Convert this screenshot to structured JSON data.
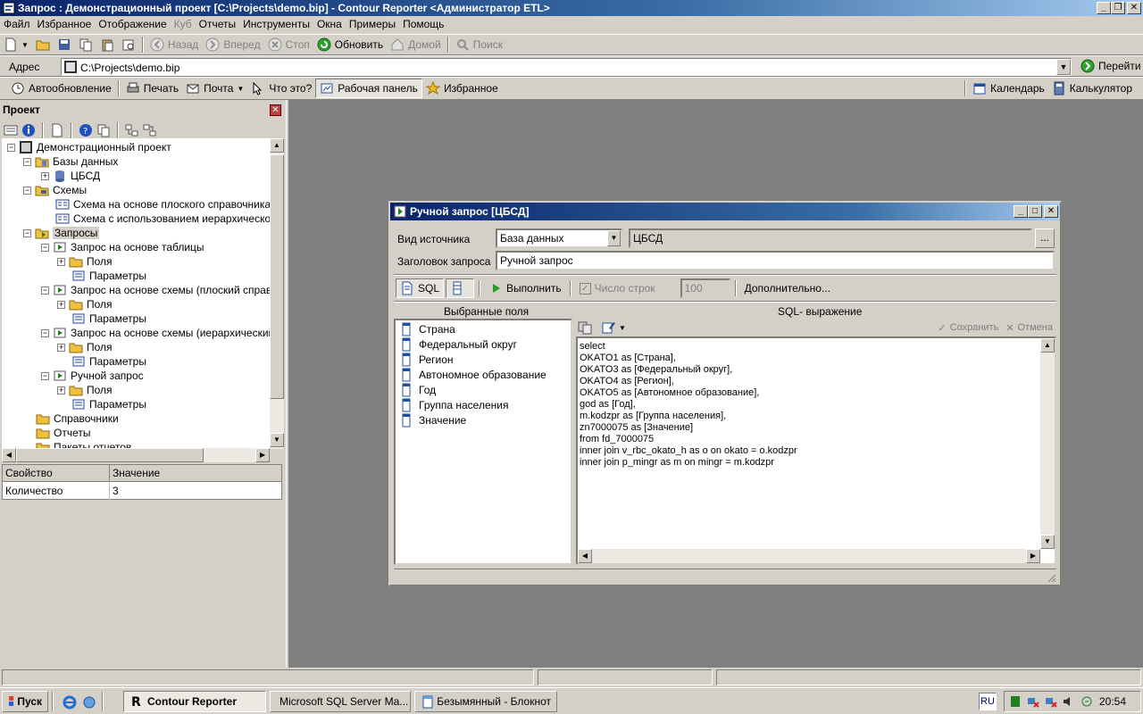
{
  "window": {
    "title": "Запрос : Демонстрационный проект [C:\\Projects\\demo.bip] - Contour Reporter <Администратор ETL>"
  },
  "menu": [
    "Файл",
    "Избранное",
    "Отображение",
    "Куб",
    "Отчеты",
    "Инструменты",
    "Окна",
    "Примеры",
    "Помощь"
  ],
  "nav_toolbar": {
    "back": "Назад",
    "forward": "Вперед",
    "stop": "Стоп",
    "refresh": "Обновить",
    "home": "Домой",
    "search": "Поиск"
  },
  "address": {
    "label": "Адрес",
    "value": "C:\\Projects\\demo.bip",
    "go": "Перейти"
  },
  "toolbar3": {
    "autorefresh": "Автообновление",
    "print": "Печать",
    "mail": "Почта",
    "whatis": "Что это?",
    "dashboard": "Рабочая панель",
    "favorites": "Избранное",
    "calendar": "Календарь",
    "calculator": "Калькулятор"
  },
  "project": {
    "title": "Проект",
    "tree": [
      "Демонстрационный проект",
      "Базы данных",
      "ЦБСД",
      "Схемы",
      "Схема на основе плоского справочника",
      "Схема с использованием иерархического к",
      "Запросы",
      "Запрос на основе таблицы",
      "Поля",
      "Параметры",
      "Запрос на основе схемы (плоский справочн",
      "Поля",
      "Параметры",
      "Запрос на основе схемы (иерархический кл",
      "Поля",
      "Параметры",
      "Ручной запрос",
      "Поля",
      "Параметры",
      "Справочники",
      "Отчеты",
      "Пакеты отчетов"
    ],
    "props": {
      "col_property": "Свойство",
      "col_value": "Значение",
      "row_name": "Количество",
      "row_value": "3"
    }
  },
  "dialog": {
    "title": "Ручной запрос [ЦБСД]",
    "source_label": "Вид источника",
    "source_value": "База данных",
    "source_db": "ЦБСД",
    "browse": "...",
    "header_label": "Заголовок запроса",
    "header_value": "Ручной запрос",
    "sql_tab": "SQL",
    "execute": "Выполнить",
    "rowcount_label": "Число строк",
    "rowcount_value": "100",
    "more": "Дополнительно...",
    "fields_title": "Выбранные поля",
    "sql_title": "SQL- выражение",
    "save": "Сохранить",
    "cancel": "Отмена",
    "fields": [
      "Страна",
      "Федеральный округ",
      "Регион",
      "Автономное образование",
      "Год",
      "Группа населения",
      "Значение"
    ],
    "sql": [
      "select",
      "OKATO1 as [Страна],",
      "OKATO3 as [Федеральный округ],",
      "OKATO4 as [Регион],",
      "OKATO5 as [Автономное образование],",
      "god as [Год],",
      "m.kodzpr as [Группа населения],",
      "zn7000075 as [Значение]",
      "from fd_7000075",
      "inner join v_rbc_okato_h as o on okato = o.kodzpr",
      "inner join p_mingr as m on mingr = m.kodzpr"
    ]
  },
  "taskbar": {
    "start": "Пуск",
    "tasks": [
      "Contour Reporter",
      "Microsoft SQL Server Ma...",
      "Безымянный - Блокнот"
    ],
    "lang": "RU",
    "clock": "20:54"
  }
}
